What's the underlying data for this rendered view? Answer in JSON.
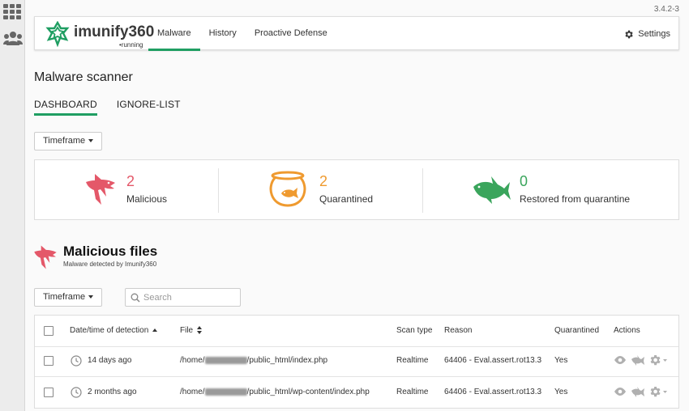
{
  "app": {
    "version": "3.4.2-3",
    "brand": "imunify360",
    "status": "running"
  },
  "sidebar": {
    "icons": [
      "apps-grid-icon",
      "users-icon"
    ]
  },
  "nav": {
    "items": [
      {
        "label": "Malware",
        "active": true
      },
      {
        "label": "History",
        "active": false
      },
      {
        "label": "Proactive Defense",
        "active": false
      }
    ],
    "settings_label": "Settings"
  },
  "page": {
    "title": "Malware scanner",
    "tabs": [
      {
        "label": "DASHBOARD",
        "active": true
      },
      {
        "label": "IGNORE-LIST",
        "active": false
      }
    ],
    "timeframe_label": "Timeframe"
  },
  "stats": [
    {
      "value": "2",
      "label": "Malicious",
      "color": "#e45869",
      "icon": "shark-icon"
    },
    {
      "value": "2",
      "label": "Quarantined",
      "color": "#ef9a2f",
      "icon": "fishbowl-icon"
    },
    {
      "value": "0",
      "label": "Restored from quarantine",
      "color": "#3aa55c",
      "icon": "fish-icon"
    }
  ],
  "malicious_files": {
    "title": "Malicious files",
    "subtitle": "Malware detected by Imunify360",
    "timeframe_label": "Timeframe",
    "search_placeholder": "Search",
    "columns": {
      "datetime": "Date/time of detection",
      "file": "File",
      "scan_type": "Scan type",
      "reason": "Reason",
      "quarantined": "Quarantined",
      "actions": "Actions"
    },
    "rows": [
      {
        "time": "14 days ago",
        "file_prefix": "/home/",
        "file_suffix": "/public_html/index.php",
        "scan_type": "Realtime",
        "reason": "64406 - Eval.assert.rot13.3",
        "quarantined": "Yes"
      },
      {
        "time": "2 months ago",
        "file_prefix": "/home/",
        "file_suffix": "/public_html/wp-content/index.php",
        "scan_type": "Realtime",
        "reason": "64406 - Eval.assert.rot13.3",
        "quarantined": "Yes"
      }
    ]
  },
  "colors": {
    "accent": "#1f9e62",
    "malicious": "#e45869",
    "quarantined": "#ef9a2f",
    "restored": "#3aa55c",
    "action_icon": "#b0b0b0"
  }
}
